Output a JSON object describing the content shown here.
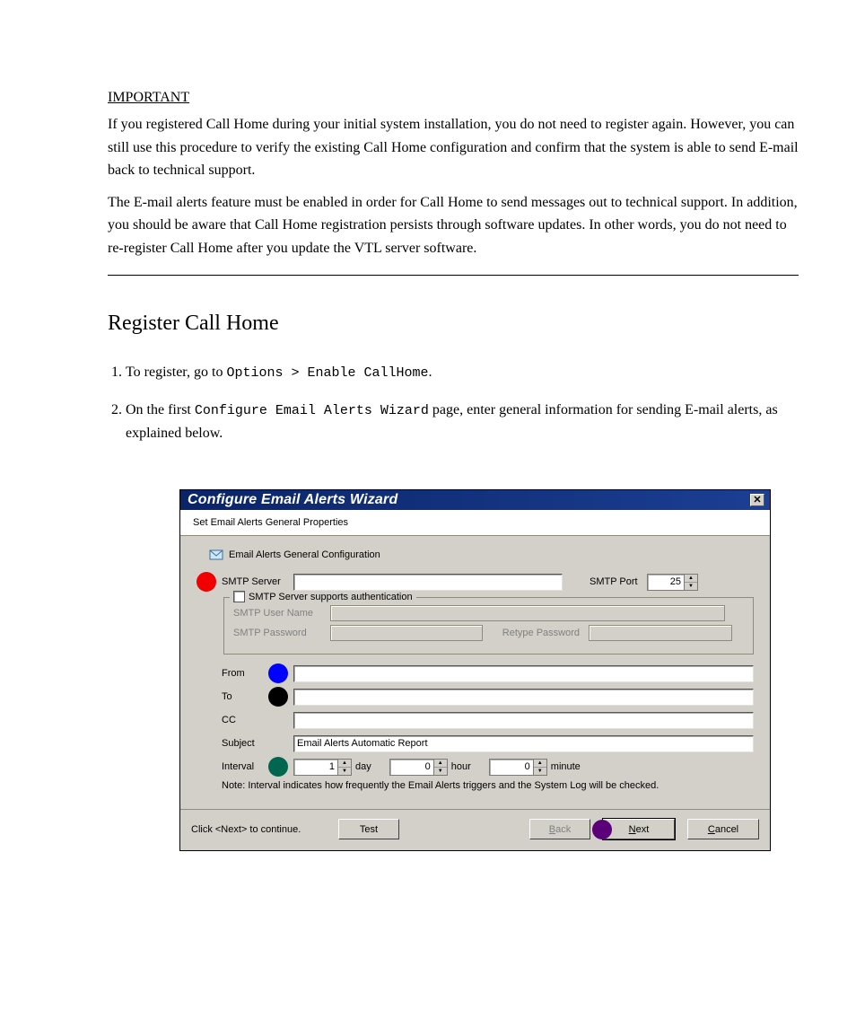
{
  "instructions": {
    "important_heading": "IMPORTANT",
    "para1": "If you registered Call Home during your initial system installation, you do not need to register again. However, you can still use this procedure to verify the existing Call Home configuration and confirm that the system is able to send E-mail back to technical support.",
    "para2": "The E-mail alerts feature must be enabled in order for Call Home to send messages out to technical support. In addition, you should be aware that Call Home registration persists through software updates. In other words, you do not need to re-register Call Home after you update the VTL server software.",
    "section_title": "Register Call Home",
    "step1_pre": "To register, go to ",
    "step1_path": "Options > Enable CallHome",
    "step1_post": ".",
    "step2_pre": "On the first ",
    "step2_path": "Configure Email Alerts Wizard",
    "step2_post": " page, enter general information for sending E-mail alerts, as explained below."
  },
  "dialog": {
    "title": "Configure Email Alerts Wizard",
    "subheader": "Set Email Alerts General Properties",
    "config_heading": "Email Alerts General Configuration",
    "smtp_server_label": "SMTP Server",
    "smtp_server_value": "",
    "smtp_port_label": "SMTP Port",
    "smtp_port_value": "25",
    "auth_legend": "SMTP Server supports authentication",
    "auth_checked": false,
    "smtp_user_label": "SMTP User Name",
    "smtp_pass_label": "SMTP Password",
    "retype_pass_label": "Retype Password",
    "from_label": "From",
    "from_value": "",
    "to_label": "To",
    "to_value": "",
    "cc_label": "CC",
    "cc_value": "",
    "subject_label": "Subject",
    "subject_value": "Email Alerts Automatic Report",
    "interval_label": "Interval",
    "interval_day_value": "1",
    "interval_day_unit": "day",
    "interval_hour_value": "0",
    "interval_hour_unit": "hour",
    "interval_minute_value": "0",
    "interval_minute_unit": "minute",
    "note": "Note: Interval indicates how frequently the Email Alerts triggers and the System Log will be checked.",
    "footer_text": "Click <Next> to continue.",
    "btn_test": "Test",
    "btn_back": "Back",
    "btn_next": "Next",
    "btn_cancel": "Cancel",
    "markers": {
      "red": "#f00000",
      "blue": "#0000ff",
      "black": "#000000",
      "green": "#006650",
      "purple": "#5b0078"
    }
  }
}
